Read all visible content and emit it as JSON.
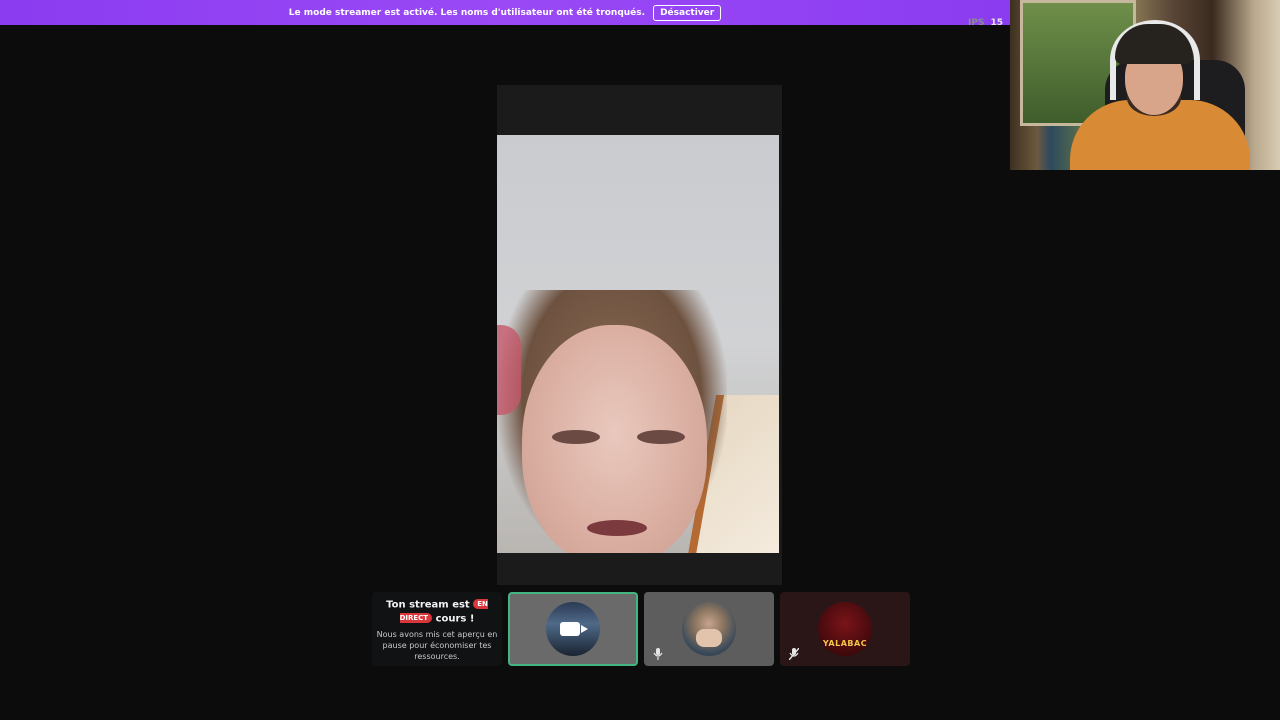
{
  "banner": {
    "message": "Le mode streamer est activé. Les noms d'utilisateur ont été tronqués.",
    "button_label": "Désactiver",
    "color": "#8b3cf0"
  },
  "fps": {
    "label": "IPS",
    "value": "15"
  },
  "stream_tile": {
    "title_before": "Ton stream est",
    "badge": "EN DIRECT",
    "title_after": "cours !",
    "description": "Nous avons mis cet aperçu en pause pour économiser tes ressources.",
    "badge_color": "#da373c"
  },
  "participants": [
    {
      "kind": "camera",
      "icon": "video-camera-icon",
      "selected": true,
      "border_color": "#43b581"
    },
    {
      "kind": "user",
      "icon": "microphone-icon"
    },
    {
      "kind": "user",
      "avatar_text": "YALABAC",
      "icon": "mic-muted-icon"
    }
  ]
}
